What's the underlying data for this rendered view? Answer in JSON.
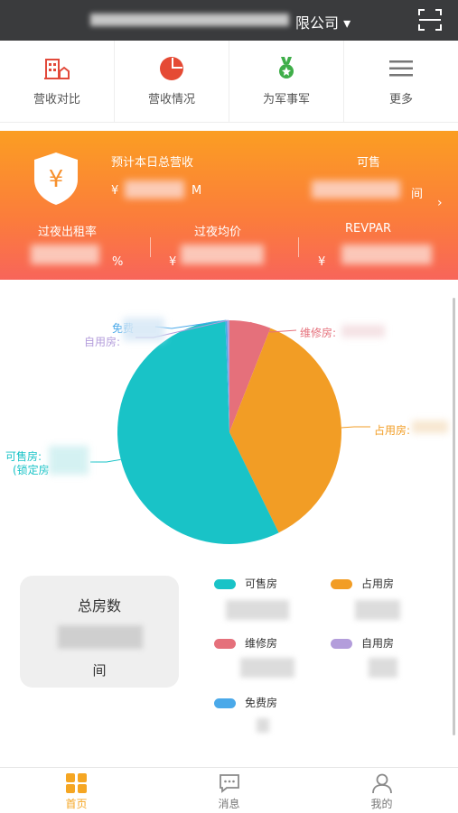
{
  "header": {
    "company_suffix": "限公司",
    "scan_icon": "scan-icon"
  },
  "quicknav": [
    {
      "label": "营收对比",
      "icon": "hotel-compare-icon"
    },
    {
      "label": "营收情况",
      "icon": "pie-chart-icon"
    },
    {
      "label": "为军事军",
      "icon": "medal-icon"
    },
    {
      "label": "更多",
      "icon": "menu-icon"
    }
  ],
  "banner": {
    "revenue_label": "预计本日总营收",
    "revenue_prefix": "¥",
    "revenue_unit": "M",
    "available_label": "可售",
    "available_unit": "间",
    "occupancy_label": "过夜出租率",
    "occupancy_unit": "%",
    "avg_price_label": "过夜均价",
    "avg_price_prefix": "¥",
    "revpar_label": "REVPAR",
    "revpar_prefix": "¥",
    "arrow": "›"
  },
  "chart_data": {
    "type": "pie",
    "slices": [
      {
        "label": "可售房",
        "value": 57,
        "color": "#19c3c7"
      },
      {
        "label": "占用房",
        "value": 37,
        "color": "#f29d25"
      },
      {
        "label": "维修房",
        "value": 6,
        "color": "#e5707b"
      },
      {
        "label": "自用房",
        "value": 0.3,
        "color": "#b39ddb"
      },
      {
        "label": "免费房",
        "value": 0.3,
        "color": "#4aa9e9"
      }
    ],
    "labels": {
      "maintenance": "维修房:",
      "occupied": "占用房:",
      "self_use": "自用房:",
      "free": "免费",
      "available": "可售房:",
      "locked": "(锁定房"
    }
  },
  "legend": {
    "total_title": "总房数",
    "total_unit": "间",
    "items": [
      {
        "label": "可售房",
        "color": "#19c3c7"
      },
      {
        "label": "占用房",
        "color": "#f29d25"
      },
      {
        "label": "维修房",
        "color": "#e5707b"
      },
      {
        "label": "自用房",
        "color": "#b39ddb"
      },
      {
        "label": "免费房",
        "color": "#4aa9e9"
      }
    ]
  },
  "tabs": [
    {
      "label": "首页",
      "icon": "home-grid-icon",
      "active": true
    },
    {
      "label": "消息",
      "icon": "message-icon",
      "active": false
    },
    {
      "label": "我的",
      "icon": "user-icon",
      "active": false
    }
  ]
}
